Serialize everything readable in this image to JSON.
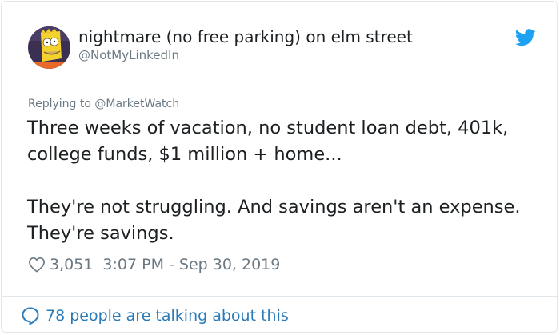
{
  "author": {
    "display_name": "nightmare (no free parking) on elm street",
    "handle": "@NotMyLinkedIn",
    "avatar_icon": "cartoon-avatar-icon"
  },
  "platform_icon": "twitter-bird-icon",
  "reply": {
    "prefix": "Replying to ",
    "target": "@MarketWatch"
  },
  "tweet": {
    "paragraphs": [
      "Three weeks of vacation, no student loan debt, 401k, college funds, $1 million + home...",
      "They're not struggling. And savings aren't an expense. They're savings."
    ]
  },
  "meta": {
    "likes": "3,051",
    "timestamp": "3:07 PM - Sep 30, 2019"
  },
  "footer": {
    "talking_text": "78 people are talking about this"
  },
  "colors": {
    "link_blue": "#2b7bb9",
    "twitter_blue": "#1da1f2",
    "secondary_text": "#697882",
    "border": "#e1e8ed"
  }
}
